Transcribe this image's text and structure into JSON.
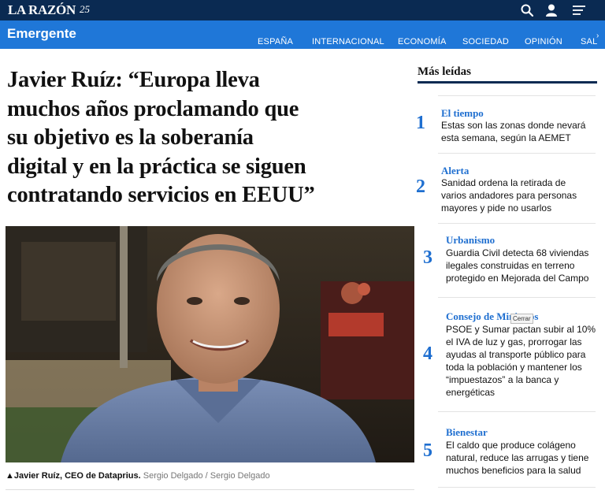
{
  "topbar": {
    "logo": "LA RAZÓN",
    "badge": "25",
    "icons": [
      "search-icon",
      "user-icon",
      "menu-icon"
    ]
  },
  "section": {
    "title": "Emergente",
    "nav": [
      "ESPAÑA",
      "INTERNACIONAL",
      "ECONOMÍA",
      "SOCIEDAD",
      "OPINIÓN",
      "SAL"
    ],
    "chevron": "›"
  },
  "article": {
    "headline_lines": [
      "Javier Ruíz: “Europa lleva",
      "muchos años proclamando que",
      "su objetivo es la soberanía",
      "digital y en la práctica se siguen",
      "contratando servicios en EEUU”"
    ],
    "caption_name": "Javier Ruíz, CEO de Dataprius.",
    "caption_credit1": "Sergio Delgado",
    "caption_sep": "/",
    "caption_credit2": "Sergio Delgado"
  },
  "sidebar": {
    "title": "Más leídas",
    "tooltip": "Cerrar",
    "items": [
      {
        "rank": "1",
        "category": "El tiempo",
        "lines": [
          "Estas son las zonas donde nevará",
          "esta semana, según la AEMET"
        ]
      },
      {
        "rank": "2",
        "category": "Alerta",
        "lines": [
          "Sanidad ordena la retirada de",
          "varios andadores para personas",
          "mayores y pide no usarlos"
        ]
      },
      {
        "rank": "3",
        "category": "Urbanismo",
        "lines": [
          "Guardia Civil detecta 68 viviendas",
          "ilegales construidas en terreno",
          "protegido en Mejorada del Campo"
        ]
      },
      {
        "rank": "4",
        "category": "Consejo de Ministros",
        "lines": [
          "PSOE y Sumar pactan subir al 10%",
          "el IVA de luz y gas, prorrogar las",
          "ayudas al transporte público para",
          "toda la población y mantener los",
          "“impuestazos” a la banca y",
          "energéticas"
        ]
      },
      {
        "rank": "5",
        "category": "Bienestar",
        "lines": [
          "El caldo que produce colágeno",
          "natural, reduce las arrugas y tiene",
          "muchos beneficios para la salud"
        ]
      }
    ]
  },
  "colors": {
    "topbar": "#0a2a52",
    "section_bar": "#1f77d8",
    "accent": "#1f6fd0"
  }
}
